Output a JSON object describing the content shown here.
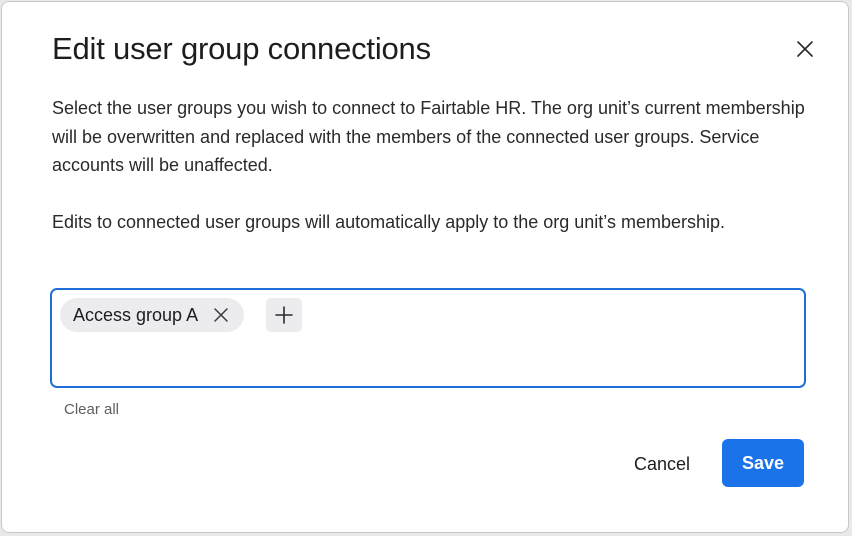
{
  "dialog": {
    "title": "Edit user group connections",
    "description_1": "Select the user groups you wish to connect to Fairtable HR. The org unit’s current membership will be overwritten and replaced with the members of the connected user groups. Service accounts will be unaffected.",
    "description_2": "Edits to connected user groups will automatically apply to the org unit’s membership.",
    "close_icon": "close-icon"
  },
  "group_field": {
    "chips": [
      {
        "label": "Access group A",
        "remove_icon": "close-icon"
      }
    ],
    "add_icon": "plus-icon"
  },
  "clear_all_label": "Clear all",
  "footer": {
    "cancel_label": "Cancel",
    "save_label": "Save"
  },
  "colors": {
    "accent": "#1a73e8",
    "focus_border": "#1f6fd6",
    "chip_background": "#ececee"
  }
}
